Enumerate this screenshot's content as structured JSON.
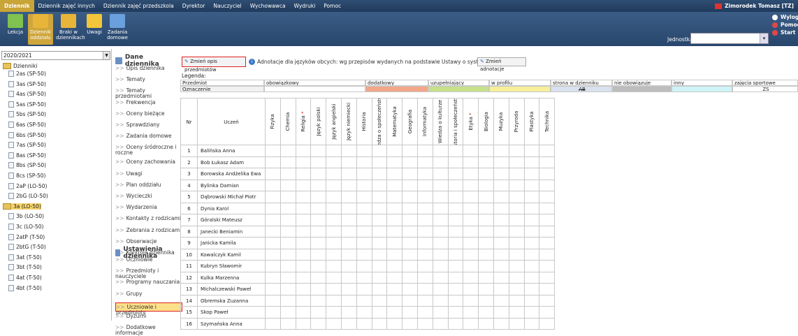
{
  "menubar": {
    "items": [
      "Dziennik",
      "Dziennik zajęć innych",
      "Dziennik zajęć przedszkola",
      "Dyrektor",
      "Nauczyciel",
      "Wychowawca",
      "Wydruki",
      "Pomoc"
    ],
    "active_index": 0,
    "user": "Zimorodek Tomasz [TZ]"
  },
  "toolbar": {
    "buttons": [
      {
        "label": "Lekcja",
        "icon": "lesson-icon"
      },
      {
        "label": "Dziennik oddziału",
        "icon": "class-journal-icon"
      },
      {
        "label": "Braki w dziennikach",
        "icon": "missing-icon"
      },
      {
        "label": "Uwagi",
        "icon": "notes-icon"
      },
      {
        "label": "Zadania domowe",
        "icon": "homework-icon"
      }
    ],
    "active_index": 1,
    "unit_label": "Jednostka:",
    "unit_value": "",
    "links": [
      "Wyloguj",
      "Pomoc",
      "Start"
    ]
  },
  "left": {
    "year": "2020/2021",
    "root": "Dzienniki",
    "classes": [
      "2as (SP-50)",
      "3as (SP-50)",
      "4as (SP-50)",
      "5as (SP-50)",
      "5bs (SP-50)",
      "6as (SP-50)",
      "6bs (SP-50)",
      "7as (SP-50)",
      "8as (SP-50)",
      "8bs (SP-50)",
      "8cs (SP-50)",
      "2aP (LO-50)",
      "2bG (LO-50)",
      "3a (LO-50)",
      "3b (LO-50)",
      "3c (LO-50)",
      "2atP (T-50)",
      "2btG (T-50)",
      "3at (T-50)",
      "3bt (T-50)",
      "4at (T-50)",
      "4bt (T-50)"
    ],
    "selected": "3a (LO-50)"
  },
  "nav": {
    "section1": "Dane dziennika",
    "items1": [
      "Opis dziennika",
      "Tematy",
      "Tematy przedmiotami",
      "Frekwencja",
      "Oceny bieżące",
      "Sprawdziany",
      "Zadania domowe",
      "Oceny śródroczne i roczne",
      "Oceny zachowania",
      "Uwagi",
      "Plan oddziału",
      "Wycieczki",
      "Wydarzenia",
      "Kontakty z rodzicami",
      "Zebrania z rodzicami",
      "Obserwacje",
      "Kontrola dziennika"
    ],
    "section2": "Ustawienia dziennika",
    "items2": [
      "Uczniowie",
      "Przedmioty i nauczyciele",
      "Programy nauczania",
      "Grupy",
      "Uczniowie i przedmioty",
      "Dyżurni",
      "Dodatkowe informacje"
    ],
    "selected": "Uczniowie i przedmioty"
  },
  "main": {
    "change_button": "Zmień opis przedmiotów",
    "annotation": "Adnotacje dla języków obcych: wg przepisów wydanych na podstawie Ustawy o systemie oświaty",
    "change_annotation_button": "Zmień adnotacje",
    "legend_label": "Legenda:",
    "legend": {
      "row1_label": "Przedmiot",
      "row2_label": "Oznaczenie",
      "columns": [
        {
          "name": "obowiązkowy",
          "color": "#ffffff",
          "mark": ""
        },
        {
          "name": "dodatkowy",
          "color": "#f2a68a",
          "mark": ""
        },
        {
          "name": "uzupełniający",
          "color": "#c7e08a",
          "mark": ""
        },
        {
          "name": "w profilu",
          "color": "#f7ef9a",
          "mark": ""
        },
        {
          "name": "strona w dzienniku",
          "color": "#d9e1ee",
          "mark": "AB"
        },
        {
          "name": "nie obowiązuje",
          "color": "#bdbdbd",
          "mark": ""
        },
        {
          "name": "inny",
          "color": "#cff4f7",
          "mark": ""
        },
        {
          "name": "zajęcia sportowe",
          "color": "#ffffff",
          "mark": "ZS"
        }
      ]
    },
    "table": {
      "header_nr": "Nr",
      "header_student": "Uczeń",
      "subjects": [
        {
          "name": "Fizyka",
          "star": false
        },
        {
          "name": "Chemia",
          "star": false
        },
        {
          "name": "Religia",
          "star": true
        },
        {
          "name": "Język polski",
          "star": false
        },
        {
          "name": "Język angielski",
          "star": false
        },
        {
          "name": "Język niemiecki",
          "star": false
        },
        {
          "name": "Historia",
          "star": false
        },
        {
          "name": "Wiedza o społeczeństwie",
          "star": false
        },
        {
          "name": "Matematyka",
          "star": false
        },
        {
          "name": "Geografia",
          "star": false
        },
        {
          "name": "Informatyka",
          "star": false
        },
        {
          "name": "Wiedza o kulturze",
          "star": false
        },
        {
          "name": "Historia i społeczeństwo",
          "star": false
        },
        {
          "name": "Etyka",
          "star": true
        },
        {
          "name": "Biologia",
          "star": false
        },
        {
          "name": "Muzyka",
          "star": false
        },
        {
          "name": "Przyroda",
          "star": false
        },
        {
          "name": "Plastyka",
          "star": false
        },
        {
          "name": "Technika",
          "star": false
        }
      ],
      "rows": [
        {
          "nr": "1",
          "name": "Balińska Anna"
        },
        {
          "nr": "2",
          "name": "Bob Łukasz Adam"
        },
        {
          "nr": "3",
          "name": "Borowska Andżelika Ewa"
        },
        {
          "nr": "4",
          "name": "Bylinka Damian"
        },
        {
          "nr": "5",
          "name": "Dąbrowski Michał Piotr"
        },
        {
          "nr": "6",
          "name": "Dynia Karol"
        },
        {
          "nr": "7",
          "name": "Góralski Mateusz"
        },
        {
          "nr": "8",
          "name": "Janecki Beniamin"
        },
        {
          "nr": "9",
          "name": "Janicka Kamila"
        },
        {
          "nr": "10",
          "name": "Kowalczyk Kamil"
        },
        {
          "nr": "11",
          "name": "Kubryn Sławomir"
        },
        {
          "nr": "12",
          "name": "Kulka Marzenna"
        },
        {
          "nr": "13",
          "name": "Michalczewski Paweł"
        },
        {
          "nr": "14",
          "name": "Obremska Zuzanna"
        },
        {
          "nr": "15",
          "name": "Skop Paweł"
        },
        {
          "nr": "16",
          "name": "Szymańska Anna"
        }
      ]
    }
  }
}
